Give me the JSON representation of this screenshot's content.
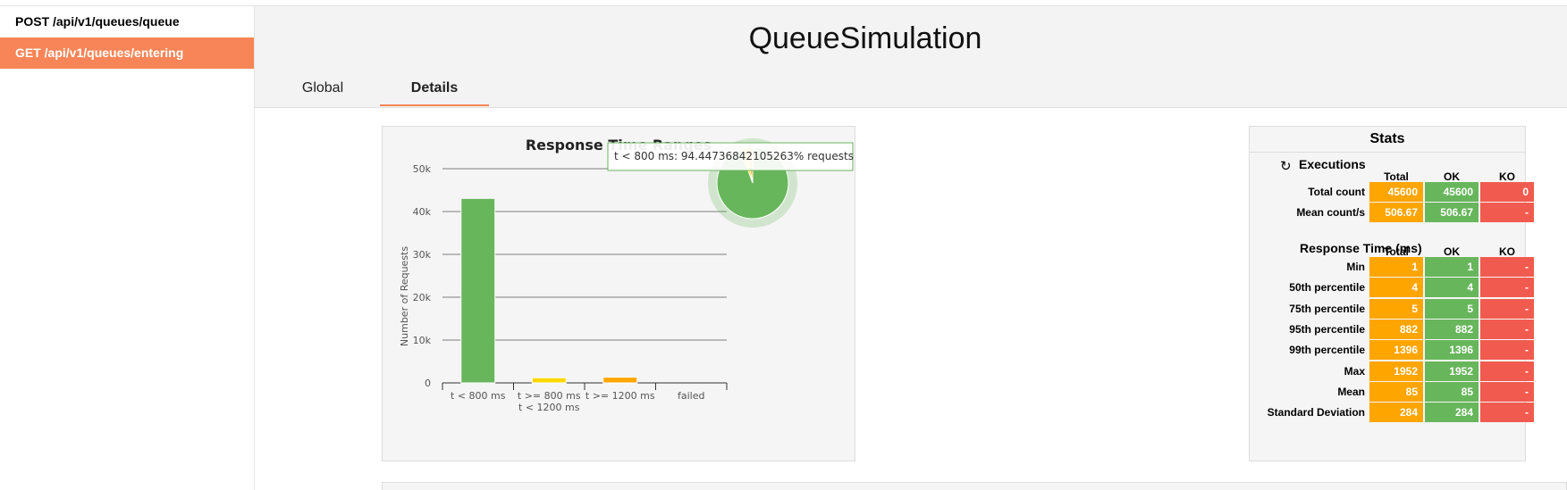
{
  "sidebar": {
    "items": [
      {
        "label": "POST /api/v1/queues/queue",
        "active": false
      },
      {
        "label": "GET /api/v1/queues/entering",
        "active": true
      }
    ]
  },
  "header": {
    "title": "QueueSimulation",
    "tabs": [
      {
        "label": "Global",
        "active": false
      },
      {
        "label": "Details",
        "active": true
      }
    ]
  },
  "colors": {
    "accent": "#f78557",
    "ok": "#68b65c",
    "total": "#ffa500",
    "ko": "#f15b4f",
    "warn": "#ffd700",
    "orange": "#ffa500"
  },
  "chart_data": {
    "type": "bar",
    "title": "Response Time Ranges",
    "xlabel": "",
    "ylabel": "Number of Requests",
    "ylim": [
      0,
      50000
    ],
    "y_ticks": [
      {
        "value": 0,
        "label": "0"
      },
      {
        "value": 10000,
        "label": "10k"
      },
      {
        "value": 20000,
        "label": "20k"
      },
      {
        "value": 30000,
        "label": "30k"
      },
      {
        "value": 40000,
        "label": "40k"
      },
      {
        "value": 50000,
        "label": "50k"
      }
    ],
    "categories": [
      [
        "t < 800 ms"
      ],
      [
        "t >= 800 ms",
        "t < 1200 ms"
      ],
      [
        "t >= 1200 ms"
      ],
      [
        "failed"
      ]
    ],
    "values": [
      43068,
      1203,
      1329,
      0
    ],
    "bar_colors": [
      "#68b65c",
      "#ffd700",
      "#ffa500",
      "#f15b4f"
    ],
    "grid": true,
    "legend": "none",
    "pie": {
      "slices": [
        {
          "label": "t < 800 ms",
          "value": 94.44736842105263,
          "color": "#68b65c"
        },
        {
          "label": "t >= 800 ms t < 1200 ms",
          "value": 2.64,
          "color": "#ffd700"
        },
        {
          "label": "t >= 1200 ms",
          "value": 2.91,
          "color": "#ffa500"
        }
      ]
    },
    "tooltip": "t < 800 ms: 94.44736842105263% requests"
  },
  "stats": {
    "title": "Stats",
    "executions_title": "Executions",
    "response_time_title": "Response Time (ms)",
    "columns": [
      "Total",
      "OK",
      "KO"
    ],
    "executions": [
      {
        "label": "Total count",
        "total": "45600",
        "ok": "45600",
        "ko": "0"
      },
      {
        "label": "Mean count/s",
        "total": "506.67",
        "ok": "506.67",
        "ko": "-"
      }
    ],
    "response_time": [
      {
        "label": "Min",
        "total": "1",
        "ok": "1",
        "ko": "-"
      },
      {
        "label": "50th percentile",
        "total": "4",
        "ok": "4",
        "ko": "-"
      },
      {
        "label": "75th percentile",
        "total": "5",
        "ok": "5",
        "ko": "-"
      },
      {
        "label": "95th percentile",
        "total": "882",
        "ok": "882",
        "ko": "-"
      },
      {
        "label": "99th percentile",
        "total": "1396",
        "ok": "1396",
        "ko": "-"
      },
      {
        "label": "Max",
        "total": "1952",
        "ok": "1952",
        "ko": "-"
      },
      {
        "label": "Mean",
        "total": "85",
        "ok": "85",
        "ko": "-"
      },
      {
        "label": "Standard Deviation",
        "total": "284",
        "ok": "284",
        "ko": "-"
      }
    ]
  }
}
